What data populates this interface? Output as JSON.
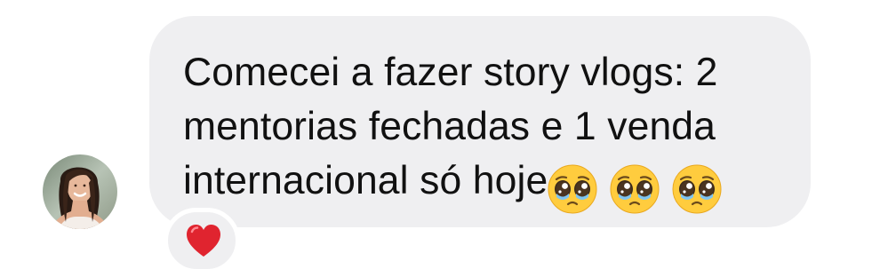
{
  "message": {
    "line1": "Comecei a fazer story vlogs: 2",
    "line2": "mentorias fechadas e 1 venda",
    "line3": "internacional só hoje",
    "emojis": [
      "pleading-face-emoji",
      "pleading-face-emoji",
      "pleading-face-emoji"
    ]
  },
  "reaction": {
    "emoji": "red-heart-emoji"
  },
  "sender": {
    "avatar": "avatar"
  },
  "colors": {
    "bubble": "#efeff1",
    "text": "#111111",
    "heart": "#e0242f",
    "emoji_face": "#ffcc3e"
  }
}
